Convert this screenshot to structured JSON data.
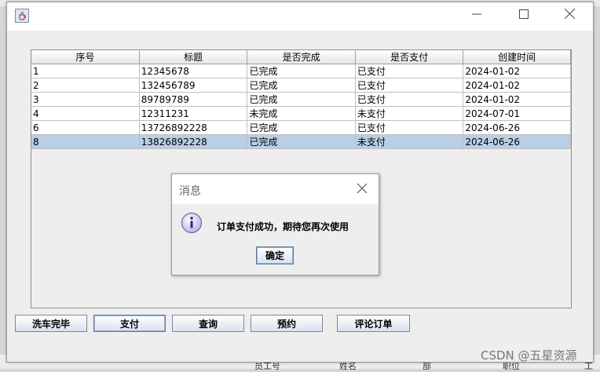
{
  "table": {
    "columns": [
      "序号",
      "标题",
      "是否完成",
      "是否支付",
      "创建时间"
    ],
    "rows": [
      [
        "1",
        "12345678",
        "已完成",
        "已支付",
        "2024-01-02"
      ],
      [
        "2",
        "132456789",
        "已完成",
        "已支付",
        "2024-01-02"
      ],
      [
        "3",
        "89789789",
        "已完成",
        "已支付",
        "2024-01-02"
      ],
      [
        "4",
        "12311231",
        "未完成",
        "未支付",
        "2024-07-01"
      ],
      [
        "6",
        "13726892228",
        "已完成",
        "已支付",
        "2024-06-26"
      ],
      [
        "8",
        "13826892228",
        "已完成",
        "未支付",
        "2024-06-26"
      ]
    ],
    "selected_row": 6
  },
  "dialog": {
    "title": "消息",
    "message": "订单支付成功，期待您再次使用",
    "ok_label": "确定"
  },
  "buttons": {
    "wash_done": "洗车完毕",
    "pay": "支付",
    "query": "查询",
    "reserve": "预约",
    "review": "评论订单"
  },
  "background": {
    "col1": "员工号",
    "col2": "姓名",
    "col3": "部",
    "col4": "职位",
    "col5": "工",
    "watermark": "CSDN @五星资源"
  },
  "colors": {
    "selection": "#b8cfe5",
    "window_bg": "#eeeeee"
  }
}
